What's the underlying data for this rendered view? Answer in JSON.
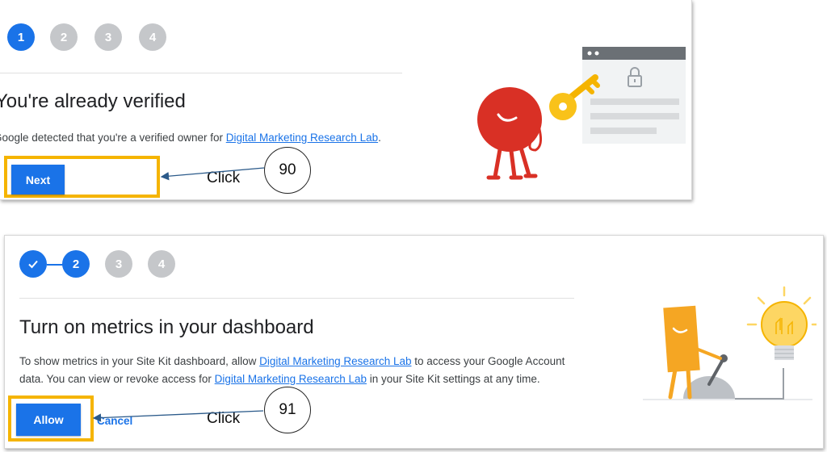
{
  "panel1": {
    "steps": [
      "1",
      "2",
      "3",
      "4"
    ],
    "heading": "You're already verified",
    "body_prefix": "Google detected that you're a verified owner for ",
    "body_link": "Digital Marketing Research Lab",
    "body_suffix": ".",
    "next_label": "Next",
    "callout_number": "90",
    "click_label": "Click"
  },
  "panel2": {
    "steps": [
      "2",
      "3",
      "4"
    ],
    "heading": "Turn on metrics in your dashboard",
    "line1_prefix": "To show metrics in your Site Kit dashboard, allow ",
    "line1_link": "Digital Marketing Research Lab",
    "line1_suffix": " to access your Google Account",
    "line2_prefix": "data. You can view or revoke access for ",
    "line2_link": "Digital Marketing Research Lab",
    "line2_suffix": " in your Site Kit settings at any time.",
    "allow_label": "Allow",
    "cancel_label": "Cancel",
    "callout_number": "91",
    "click_label": "Click"
  },
  "colors": {
    "accent": "#1a73e8",
    "highlight": "#f5b400",
    "step_inactive": "#c5c7ca"
  },
  "icons": [
    "lock-icon",
    "key-icon",
    "checkmark-icon",
    "lightbulb-icon"
  ]
}
